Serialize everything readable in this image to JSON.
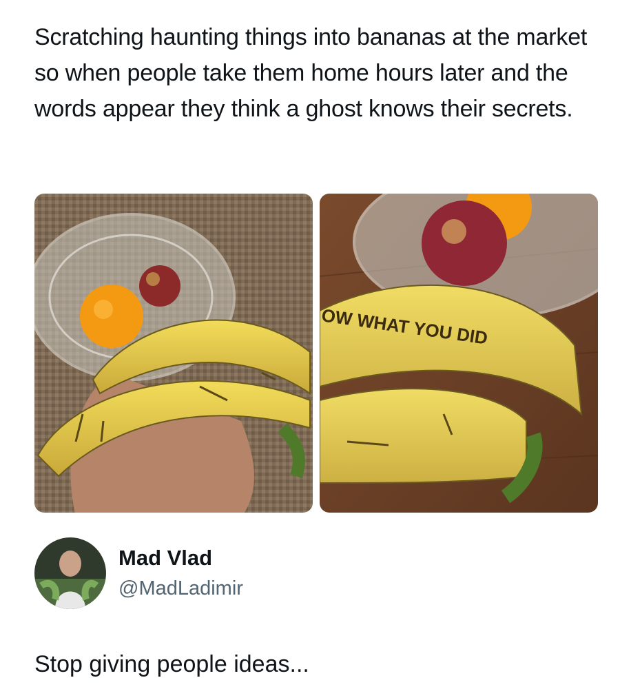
{
  "post": {
    "text": "Scratching haunting things into bananas at the market so when people take them home hours later and the words appear they think a ghost knows their secrets.",
    "images": [
      {
        "name": "bananas-hand-photo"
      },
      {
        "name": "bananas-engraved-photo",
        "banana_text": "OW WHAT YOU DID"
      }
    ]
  },
  "author": {
    "name": "Mad Vlad",
    "handle": "@MadLadimir",
    "avatar_icon": "avatar-photo"
  },
  "caption": "Stop giving people ideas..."
}
